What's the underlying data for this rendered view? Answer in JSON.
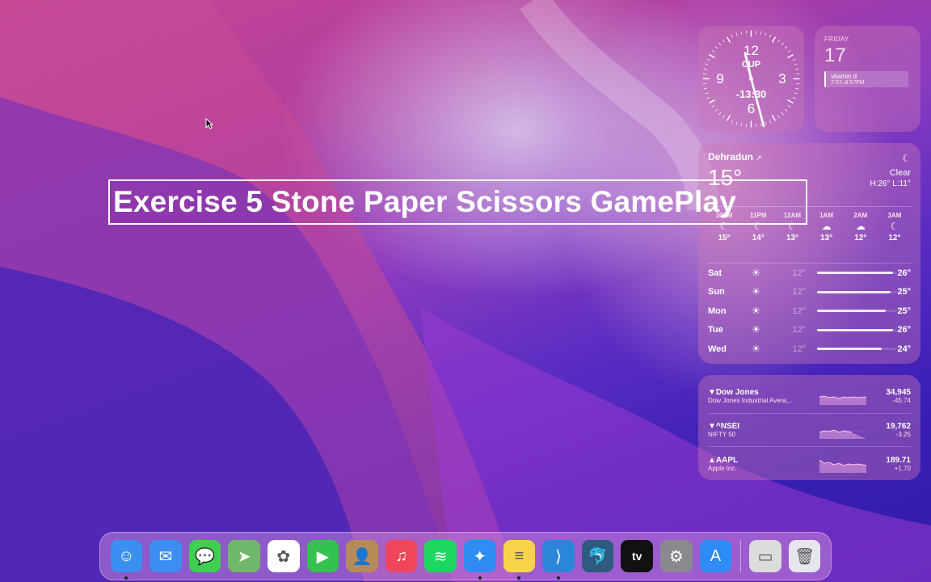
{
  "overlay_title": "Exercise 5 Stone Paper Scissors GamePlay",
  "clock": {
    "numerals": [
      "12",
      "3",
      "6",
      "9"
    ],
    "city": "CUP",
    "offset": "-13:30"
  },
  "calendar": {
    "day": "FRIDAY",
    "date": "17",
    "event_title": "vitamin d",
    "event_time": "7:57–8:57PM"
  },
  "weather": {
    "city": "Dehradun",
    "location_icon": "location-arrow-icon",
    "temp": "15°",
    "condition_icon": "moon-icon",
    "condition": "Clear",
    "high_low": "H:26° L:11°",
    "hourly": [
      {
        "label": "10PM",
        "icon": "moon-icon",
        "temp": "15°"
      },
      {
        "label": "11PM",
        "icon": "moon-icon",
        "temp": "14°"
      },
      {
        "label": "12AM",
        "icon": "moon-icon",
        "temp": "13°"
      },
      {
        "label": "1AM",
        "icon": "cloud-moon-icon",
        "temp": "13°"
      },
      {
        "label": "2AM",
        "icon": "cloud-moon-icon",
        "temp": "12°"
      },
      {
        "label": "3AM",
        "icon": "moon-icon",
        "temp": "12°"
      }
    ],
    "daily": [
      {
        "day": "Sat",
        "icon": "sun-icon",
        "low": "12°",
        "high": "26°",
        "range_fraction": 0.95
      },
      {
        "day": "Sun",
        "icon": "sun-icon",
        "low": "12°",
        "high": "25°",
        "range_fraction": 0.92
      },
      {
        "day": "Mon",
        "icon": "sun-icon",
        "low": "12°",
        "high": "25°",
        "range_fraction": 0.86
      },
      {
        "day": "Tue",
        "icon": "sun-icon",
        "low": "12°",
        "high": "26°",
        "range_fraction": 0.95
      },
      {
        "day": "Wed",
        "icon": "sun-icon",
        "low": "12°",
        "high": "24°",
        "range_fraction": 0.8
      }
    ]
  },
  "stocks": [
    {
      "symbol": "▼Dow Jones",
      "name": "Dow Jones Industrial Avera...",
      "price": "34,945",
      "change": "-45.74"
    },
    {
      "symbol": "▼^NSEI",
      "name": "NIFTY 50",
      "price": "19,762",
      "change": "-3.25"
    },
    {
      "symbol": "▲AAPL",
      "name": "Apple Inc.",
      "price": "189.71",
      "change": "+1.70"
    }
  ],
  "dock": [
    {
      "name": "finder-icon",
      "bg": "#3b8ff0",
      "glyph": "☺",
      "running": true
    },
    {
      "name": "mail-icon",
      "bg": "#3d8ef2",
      "glyph": "✉",
      "running": false
    },
    {
      "name": "messages-icon",
      "bg": "#3fcf50",
      "glyph": "💬",
      "running": false
    },
    {
      "name": "maps-icon",
      "bg": "#6fb86a",
      "glyph": "➤",
      "running": false
    },
    {
      "name": "photos-icon",
      "bg": "#ffffff",
      "glyph": "✿",
      "running": false
    },
    {
      "name": "facetime-icon",
      "bg": "#33c24d",
      "glyph": "▶",
      "running": false
    },
    {
      "name": "contacts-icon",
      "bg": "#b58b5a",
      "glyph": "👤",
      "running": false
    },
    {
      "name": "music-icon",
      "bg": "#f1455b",
      "glyph": "♫",
      "running": false
    },
    {
      "name": "spotify-icon",
      "bg": "#1ed760",
      "glyph": "≋",
      "running": false
    },
    {
      "name": "safari-icon",
      "bg": "#2f8cf0",
      "glyph": "✦",
      "running": true
    },
    {
      "name": "notes-icon",
      "bg": "#f7d34b",
      "glyph": "≡",
      "running": true
    },
    {
      "name": "vscode-icon",
      "bg": "#2b86d9",
      "glyph": "⟩",
      "running": true
    },
    {
      "name": "mysql-workbench-icon",
      "bg": "#2e5b7f",
      "glyph": "🐬",
      "running": false
    },
    {
      "name": "apple-tv-icon",
      "bg": "#111111",
      "glyph": "tv",
      "running": false
    },
    {
      "name": "system-settings-icon",
      "bg": "#8a8a8e",
      "glyph": "⚙",
      "running": false
    },
    {
      "name": "app-store-icon",
      "bg": "#2d8cf5",
      "glyph": "A",
      "running": false
    }
  ],
  "dock_right": [
    {
      "name": "screen-recording-thumbnail-icon",
      "bg": "#dcdcdc",
      "glyph": "▭"
    },
    {
      "name": "trash-icon",
      "bg": "#e6e6ee",
      "glyph": "🗑"
    }
  ]
}
